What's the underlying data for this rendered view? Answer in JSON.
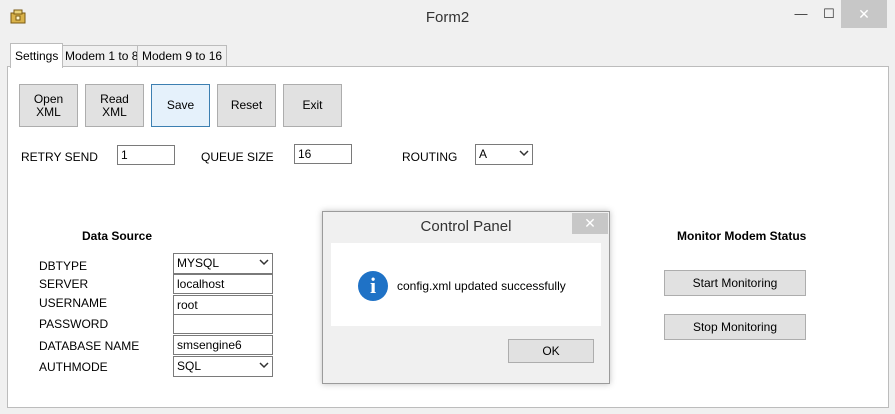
{
  "window": {
    "title": "Form2",
    "icon": "app-icon",
    "controls": {
      "minimize": "—",
      "maximize": "☐",
      "close": "✕"
    }
  },
  "tabs": [
    {
      "label": "Settings",
      "active": true
    },
    {
      "label": "Modem 1 to 8",
      "active": false
    },
    {
      "label": "Modem 9 to 16",
      "active": false
    }
  ],
  "toolbar": {
    "open_xml": "Open\nXML",
    "read_xml": "Read\nXML",
    "save": "Save",
    "reset": "Reset",
    "exit": "Exit"
  },
  "settings": {
    "retry_send_label": "RETRY SEND",
    "retry_send_value": "1",
    "queue_size_label": "QUEUE SIZE",
    "queue_size_value": "16",
    "routing_label": "ROUTING",
    "routing_value": "A"
  },
  "data_source": {
    "heading": "Data Source",
    "dbtype_label": "DBTYPE",
    "dbtype_value": "MYSQL",
    "server_label": "SERVER",
    "server_value": "localhost",
    "username_label": "USERNAME",
    "username_value": "root",
    "password_label": "PASSWORD",
    "password_value": "",
    "database_name_label": "DATABASE NAME",
    "database_name_value": "smsengine6",
    "authmode_label": "AUTHMODE",
    "authmode_value": "SQL"
  },
  "monitor": {
    "heading": "Monitor Modem Status",
    "start": "Start Monitoring",
    "stop": "Stop Monitoring"
  },
  "dialog": {
    "title": "Control Panel",
    "message": "config.xml updated successfully",
    "ok": "OK",
    "close": "✕",
    "icon": "info-icon"
  }
}
